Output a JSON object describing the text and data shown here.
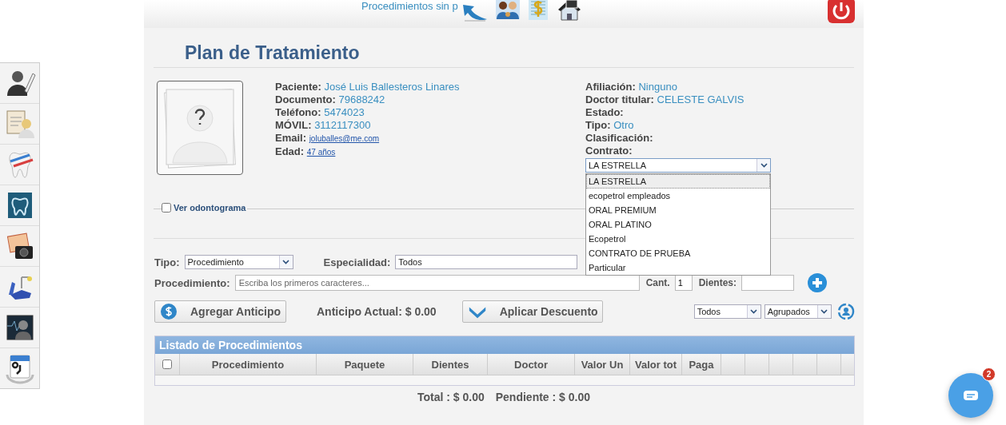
{
  "header": {
    "link": "Procedimientos sin p"
  },
  "title": "Plan de Tratamiento",
  "patient": {
    "left": [
      {
        "label": "Paciente:",
        "value": "José Luis Ballesteros Linares",
        "kind": "text"
      },
      {
        "label": "Documento:",
        "value": "79688242",
        "kind": "text"
      },
      {
        "label": "Teléfono:",
        "value": "5474023",
        "kind": "text"
      },
      {
        "label": "MÓVIL:",
        "value": "3112117300",
        "kind": "text"
      },
      {
        "label": "Email:",
        "value": "joluballes@me.com",
        "kind": "link"
      },
      {
        "label": "Edad:",
        "value": "47 años",
        "kind": "link"
      }
    ],
    "right": [
      {
        "label": "Afiliación:",
        "value": "Ninguno"
      },
      {
        "label": "Doctor titular:",
        "value": "CELESTE GALVIS"
      },
      {
        "label": "Estado:"
      },
      {
        "label": "Tipo:",
        "value": "Otro"
      },
      {
        "label": "Clasificación:"
      },
      {
        "label": "Contrato:"
      }
    ]
  },
  "contract_select": {
    "value": "LA ESTRELLA",
    "expanded": true,
    "options": [
      {
        "label": "LA ESTRELLA",
        "selected": true
      },
      {
        "label": "ecopetrol empleados",
        "selected": false
      },
      {
        "label": "ORAL PREMIUM",
        "selected": false
      },
      {
        "label": "ORAL PLATINO",
        "selected": false
      },
      {
        "label": "Ecopetrol",
        "selected": false
      },
      {
        "label": "CONTRATO DE PRUEBA",
        "selected": false
      },
      {
        "label": "Particular",
        "selected": false
      }
    ]
  },
  "odontogram": {
    "label": "Ver odontograma",
    "checked": false
  },
  "form": {
    "tipo": {
      "label": "Tipo:",
      "value": "Procedimiento"
    },
    "especialidad": {
      "label": "Especialidad:",
      "value": "Todos"
    },
    "procedimiento": {
      "label": "Procedimiento:",
      "placeholder": "Escriba los primeros caracteres..."
    },
    "cant": {
      "label": "Cant.",
      "value": "1"
    },
    "dientes": {
      "label": "Dientes:"
    }
  },
  "actions": {
    "anticipo_button": "Agregar Anticipo",
    "anticipo_actual": "Anticipo Actual: $ 0.00",
    "descuento_button": "Aplicar Descuento",
    "filter_1": "Todos",
    "filter_2": "Agrupados"
  },
  "table": {
    "title": "Listado de Procedimientos",
    "select_all": false,
    "columns": [
      "Procedimiento",
      "Paquete",
      "Dientes",
      "Doctor",
      "Valor Un",
      "Valor tot",
      "Paga"
    ]
  },
  "totals": {
    "total": "Total : $ 0.00",
    "pendiente": "Pendiente : $ 0.00"
  },
  "chat": {
    "badge": "2"
  }
}
